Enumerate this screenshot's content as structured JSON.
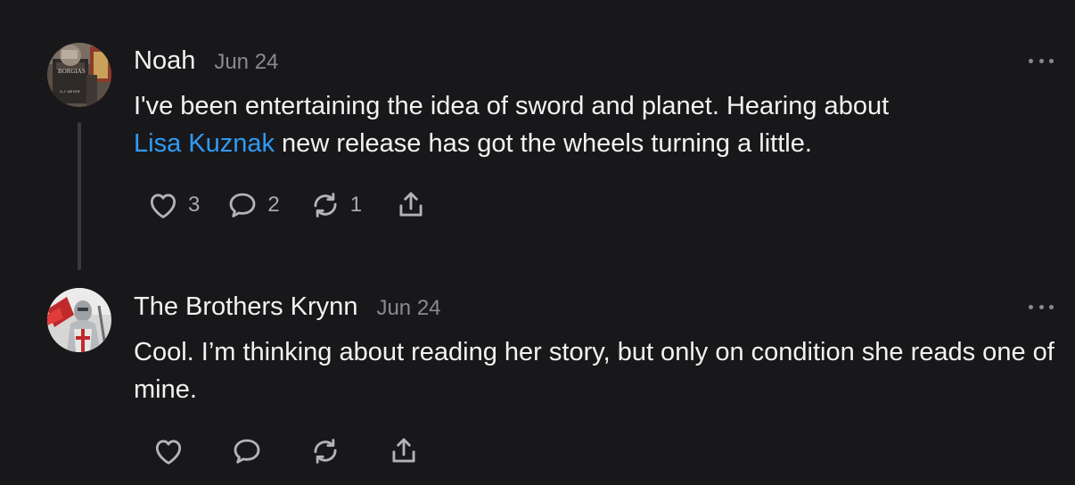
{
  "comments": [
    {
      "author": "Noah",
      "date": "Jun 24",
      "text_before": "I've been entertaining the idea of sword and planet. Hearing about",
      "mention": "Lisa Kuznak",
      "text_after": " new release has got the wheels turning a little.",
      "likes": "3",
      "replies": "2",
      "restacks": "1",
      "avatar_cover_title": "BORGIAS",
      "avatar_cover_author": "G.J. MEYER"
    },
    {
      "author": "The Brothers Krynn",
      "date": "Jun 24",
      "text": "Cool. I’m thinking about reading her story, but only on condition she reads one of mine."
    }
  ],
  "icons": {
    "more": "more-horizontal-icon",
    "like": "heart-icon",
    "reply": "speech-bubble-icon",
    "restack": "restack-arrows-icon",
    "share": "share-upload-icon"
  },
  "colors": {
    "background": "#18181a",
    "text": "#f2f2f2",
    "muted": "#8a8a8e",
    "mention": "#2f9bf5",
    "thread_line": "#3a3a3c"
  }
}
